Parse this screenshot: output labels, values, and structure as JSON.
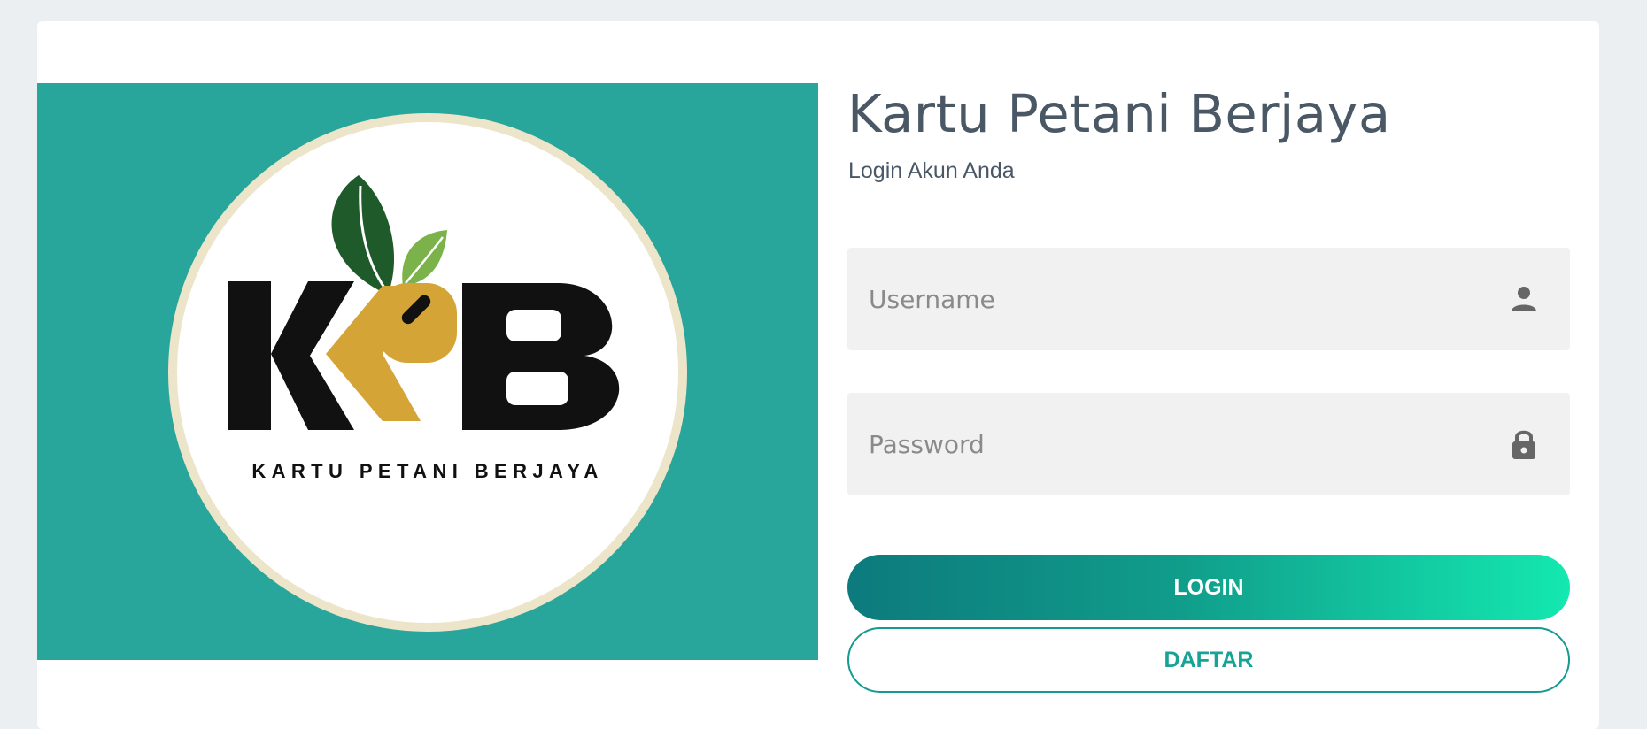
{
  "logo": {
    "caption": "KARTU PETANI BERJAYA",
    "monogram": "KPB",
    "icon": "kpb-logo-with-leaves",
    "colors": {
      "banner": "#29a69b",
      "ring": "#ece5c9",
      "letters": "#111111",
      "gold": "#d4a437",
      "leaf_dark": "#1e5a2a",
      "leaf_light": "#7bb24a"
    }
  },
  "header": {
    "title": "Kartu Petani Berjaya",
    "subtitle": "Login Akun Anda"
  },
  "form": {
    "username": {
      "placeholder": "Username",
      "value": "",
      "icon": "user-icon"
    },
    "password": {
      "placeholder": "Password",
      "value": "",
      "icon": "lock-icon"
    },
    "login_label": "LOGIN",
    "register_label": "DAFTAR"
  },
  "theme": {
    "accent": "#149a90",
    "gradient_start": "#0d7a7d",
    "gradient_end": "#14e8b0",
    "text": "#4a5866"
  }
}
